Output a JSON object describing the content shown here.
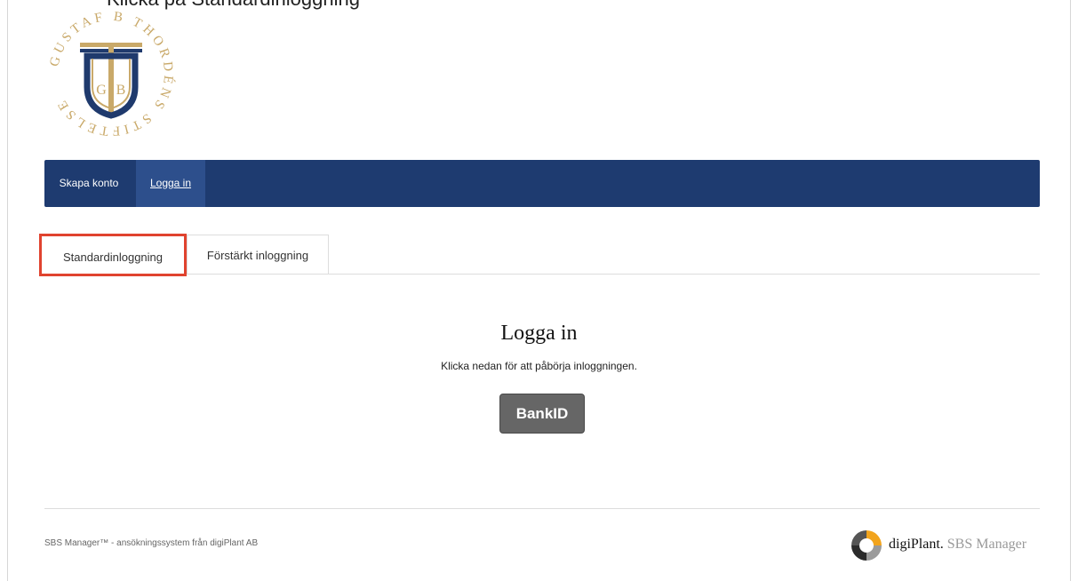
{
  "caption": "Klicka på Standardinloggning",
  "logo": {
    "icon": "gustaf-b-thordens-stiftelse-logo",
    "text": "GUSTAF B THORDÉNS STIFTELSE",
    "letters": "G B",
    "colors": {
      "gold": "#c9a969",
      "navy": "#1f3a6d"
    }
  },
  "nav": {
    "items": [
      {
        "label": "Skapa konto"
      },
      {
        "label": "Logga in"
      }
    ]
  },
  "tabs": [
    {
      "label": "Standardinloggning",
      "highlighted": true
    },
    {
      "label": "Förstärkt inloggning"
    }
  ],
  "login": {
    "title": "Logga in",
    "subtitle": "Klicka nedan för att påbörja inloggningen.",
    "button": "BankID"
  },
  "footer": {
    "text": "SBS Manager™ - ansökningssystem från digiPlant AB",
    "brand_primary": "digiPlant.",
    "brand_secondary": "SBS Manager",
    "brand_icon": "digiplant-ring-icon"
  },
  "colors": {
    "navbar": "#1e3b70",
    "navbar_active": "#2d4f8c",
    "highlight": "#e0432f",
    "button": "#666666"
  }
}
